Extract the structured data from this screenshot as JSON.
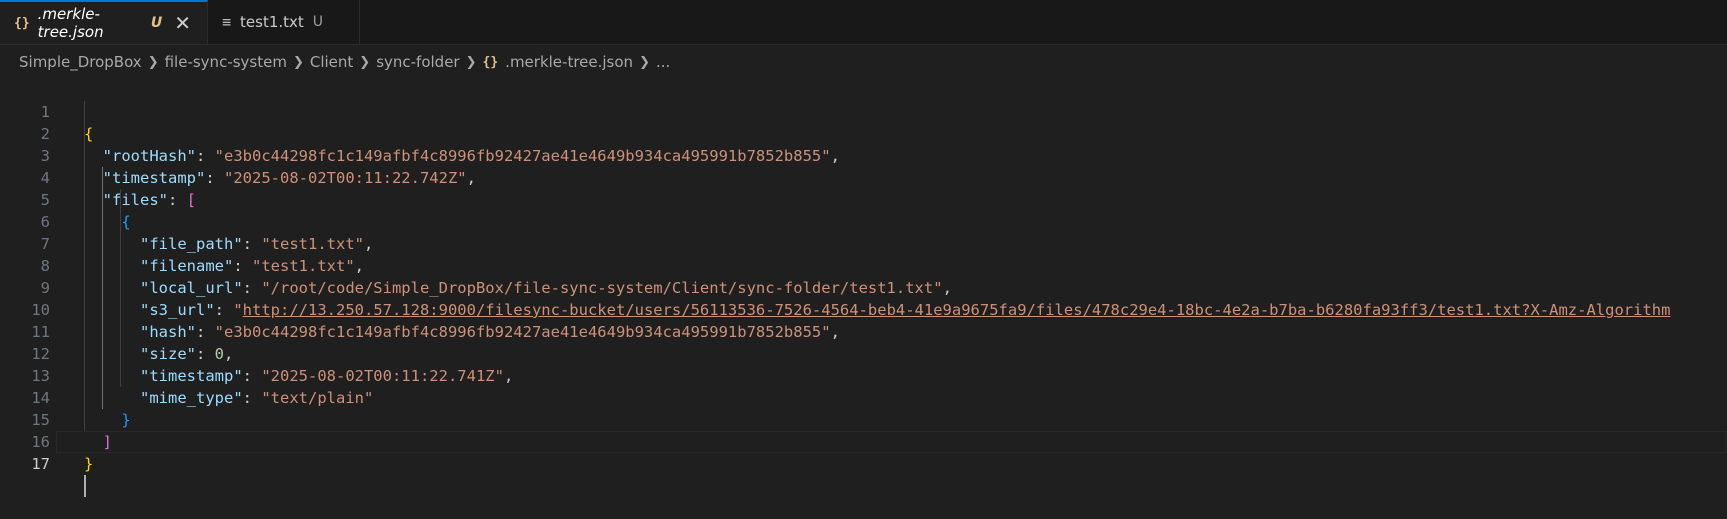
{
  "tabs": [
    {
      "icon": "{}",
      "name": ".merkle-tree.json",
      "status": "U",
      "close": "✕"
    },
    {
      "icon": "≡",
      "name": "test1.txt",
      "status": "U"
    }
  ],
  "breadcrumb": {
    "items": [
      "Simple_DropBox",
      "file-sync-system",
      "Client",
      "sync-folder"
    ],
    "file_icon": "{}",
    "file": ".merkle-tree.json",
    "more": "..."
  },
  "editor": {
    "line_numbers": [
      "1",
      "2",
      "3",
      "4",
      "5",
      "6",
      "7",
      "8",
      "9",
      "10",
      "11",
      "12",
      "13",
      "14",
      "15",
      "16",
      "17"
    ],
    "json": {
      "rootHash_key": "\"rootHash\"",
      "rootHash_val": "\"e3b0c44298fc1c149afbf4c8996fb92427ae41e4649b934ca495991b7852b855\"",
      "timestamp_key": "\"timestamp\"",
      "timestamp_val": "\"2025-08-02T00:11:22.742Z\"",
      "files_key": "\"files\"",
      "file_path_key": "\"file_path\"",
      "file_path_val": "\"test1.txt\"",
      "filename_key": "\"filename\"",
      "filename_val": "\"test1.txt\"",
      "local_url_key": "\"local_url\"",
      "local_url_val": "\"/root/code/Simple_DropBox/file-sync-system/Client/sync-folder/test1.txt\"",
      "s3_url_key": "\"s3_url\"",
      "s3_url_quote": "\"",
      "s3_url_link": "http://13.250.57.128:9000/filesync-bucket/users/56113536-7526-4564-beb4-41e9a9675fa9/files/478c29e4-18bc-4e2a-b7ba-b6280fa93ff3/test1.txt?X-Amz-Algorithm",
      "hash_key": "\"hash\"",
      "hash_val": "\"e3b0c44298fc1c149afbf4c8996fb92427ae41e4649b934ca495991b7852b855\"",
      "size_key": "\"size\"",
      "size_val": "0",
      "file_timestamp_key": "\"timestamp\"",
      "file_timestamp_val": "\"2025-08-02T00:11:22.741Z\"",
      "mime_type_key": "\"mime_type\"",
      "mime_type_val": "\"text/plain\""
    }
  },
  "colors": {
    "key": "#9cdcfe",
    "string": "#ce9178",
    "number": "#b5cea8",
    "brace_level1": "#ffd700",
    "brace_level2": "#da70d6",
    "brace_level3": "#179fff",
    "accent": "#0078d4"
  }
}
